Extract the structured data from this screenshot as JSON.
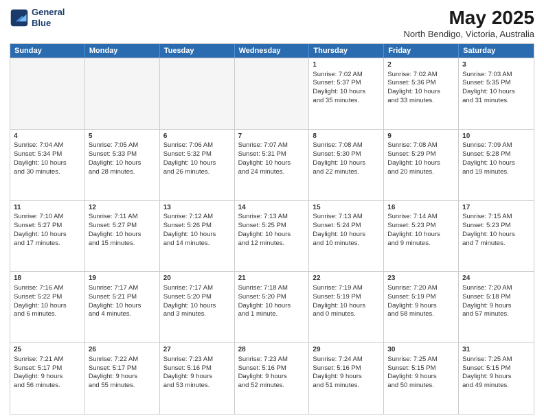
{
  "header": {
    "logo_line1": "General",
    "logo_line2": "Blue",
    "title": "May 2025",
    "subtitle": "North Bendigo, Victoria, Australia"
  },
  "calendar": {
    "days_of_week": [
      "Sunday",
      "Monday",
      "Tuesday",
      "Wednesday",
      "Thursday",
      "Friday",
      "Saturday"
    ],
    "rows": [
      [
        {
          "day": "",
          "empty": true
        },
        {
          "day": "",
          "empty": true
        },
        {
          "day": "",
          "empty": true
        },
        {
          "day": "",
          "empty": true
        },
        {
          "day": "1",
          "lines": [
            "Sunrise: 7:02 AM",
            "Sunset: 5:37 PM",
            "Daylight: 10 hours",
            "and 35 minutes."
          ]
        },
        {
          "day": "2",
          "lines": [
            "Sunrise: 7:02 AM",
            "Sunset: 5:36 PM",
            "Daylight: 10 hours",
            "and 33 minutes."
          ]
        },
        {
          "day": "3",
          "lines": [
            "Sunrise: 7:03 AM",
            "Sunset: 5:35 PM",
            "Daylight: 10 hours",
            "and 31 minutes."
          ]
        }
      ],
      [
        {
          "day": "4",
          "lines": [
            "Sunrise: 7:04 AM",
            "Sunset: 5:34 PM",
            "Daylight: 10 hours",
            "and 30 minutes."
          ]
        },
        {
          "day": "5",
          "lines": [
            "Sunrise: 7:05 AM",
            "Sunset: 5:33 PM",
            "Daylight: 10 hours",
            "and 28 minutes."
          ]
        },
        {
          "day": "6",
          "lines": [
            "Sunrise: 7:06 AM",
            "Sunset: 5:32 PM",
            "Daylight: 10 hours",
            "and 26 minutes."
          ]
        },
        {
          "day": "7",
          "lines": [
            "Sunrise: 7:07 AM",
            "Sunset: 5:31 PM",
            "Daylight: 10 hours",
            "and 24 minutes."
          ]
        },
        {
          "day": "8",
          "lines": [
            "Sunrise: 7:08 AM",
            "Sunset: 5:30 PM",
            "Daylight: 10 hours",
            "and 22 minutes."
          ]
        },
        {
          "day": "9",
          "lines": [
            "Sunrise: 7:08 AM",
            "Sunset: 5:29 PM",
            "Daylight: 10 hours",
            "and 20 minutes."
          ]
        },
        {
          "day": "10",
          "lines": [
            "Sunrise: 7:09 AM",
            "Sunset: 5:28 PM",
            "Daylight: 10 hours",
            "and 19 minutes."
          ]
        }
      ],
      [
        {
          "day": "11",
          "lines": [
            "Sunrise: 7:10 AM",
            "Sunset: 5:27 PM",
            "Daylight: 10 hours",
            "and 17 minutes."
          ]
        },
        {
          "day": "12",
          "lines": [
            "Sunrise: 7:11 AM",
            "Sunset: 5:27 PM",
            "Daylight: 10 hours",
            "and 15 minutes."
          ]
        },
        {
          "day": "13",
          "lines": [
            "Sunrise: 7:12 AM",
            "Sunset: 5:26 PM",
            "Daylight: 10 hours",
            "and 14 minutes."
          ]
        },
        {
          "day": "14",
          "lines": [
            "Sunrise: 7:13 AM",
            "Sunset: 5:25 PM",
            "Daylight: 10 hours",
            "and 12 minutes."
          ]
        },
        {
          "day": "15",
          "lines": [
            "Sunrise: 7:13 AM",
            "Sunset: 5:24 PM",
            "Daylight: 10 hours",
            "and 10 minutes."
          ]
        },
        {
          "day": "16",
          "lines": [
            "Sunrise: 7:14 AM",
            "Sunset: 5:23 PM",
            "Daylight: 10 hours",
            "and 9 minutes."
          ]
        },
        {
          "day": "17",
          "lines": [
            "Sunrise: 7:15 AM",
            "Sunset: 5:23 PM",
            "Daylight: 10 hours",
            "and 7 minutes."
          ]
        }
      ],
      [
        {
          "day": "18",
          "lines": [
            "Sunrise: 7:16 AM",
            "Sunset: 5:22 PM",
            "Daylight: 10 hours",
            "and 6 minutes."
          ]
        },
        {
          "day": "19",
          "lines": [
            "Sunrise: 7:17 AM",
            "Sunset: 5:21 PM",
            "Daylight: 10 hours",
            "and 4 minutes."
          ]
        },
        {
          "day": "20",
          "lines": [
            "Sunrise: 7:17 AM",
            "Sunset: 5:20 PM",
            "Daylight: 10 hours",
            "and 3 minutes."
          ]
        },
        {
          "day": "21",
          "lines": [
            "Sunrise: 7:18 AM",
            "Sunset: 5:20 PM",
            "Daylight: 10 hours",
            "and 1 minute."
          ]
        },
        {
          "day": "22",
          "lines": [
            "Sunrise: 7:19 AM",
            "Sunset: 5:19 PM",
            "Daylight: 10 hours",
            "and 0 minutes."
          ]
        },
        {
          "day": "23",
          "lines": [
            "Sunrise: 7:20 AM",
            "Sunset: 5:19 PM",
            "Daylight: 9 hours",
            "and 58 minutes."
          ]
        },
        {
          "day": "24",
          "lines": [
            "Sunrise: 7:20 AM",
            "Sunset: 5:18 PM",
            "Daylight: 9 hours",
            "and 57 minutes."
          ]
        }
      ],
      [
        {
          "day": "25",
          "lines": [
            "Sunrise: 7:21 AM",
            "Sunset: 5:17 PM",
            "Daylight: 9 hours",
            "and 56 minutes."
          ]
        },
        {
          "day": "26",
          "lines": [
            "Sunrise: 7:22 AM",
            "Sunset: 5:17 PM",
            "Daylight: 9 hours",
            "and 55 minutes."
          ]
        },
        {
          "day": "27",
          "lines": [
            "Sunrise: 7:23 AM",
            "Sunset: 5:16 PM",
            "Daylight: 9 hours",
            "and 53 minutes."
          ]
        },
        {
          "day": "28",
          "lines": [
            "Sunrise: 7:23 AM",
            "Sunset: 5:16 PM",
            "Daylight: 9 hours",
            "and 52 minutes."
          ]
        },
        {
          "day": "29",
          "lines": [
            "Sunrise: 7:24 AM",
            "Sunset: 5:16 PM",
            "Daylight: 9 hours",
            "and 51 minutes."
          ]
        },
        {
          "day": "30",
          "lines": [
            "Sunrise: 7:25 AM",
            "Sunset: 5:15 PM",
            "Daylight: 9 hours",
            "and 50 minutes."
          ]
        },
        {
          "day": "31",
          "lines": [
            "Sunrise: 7:25 AM",
            "Sunset: 5:15 PM",
            "Daylight: 9 hours",
            "and 49 minutes."
          ]
        }
      ]
    ]
  }
}
